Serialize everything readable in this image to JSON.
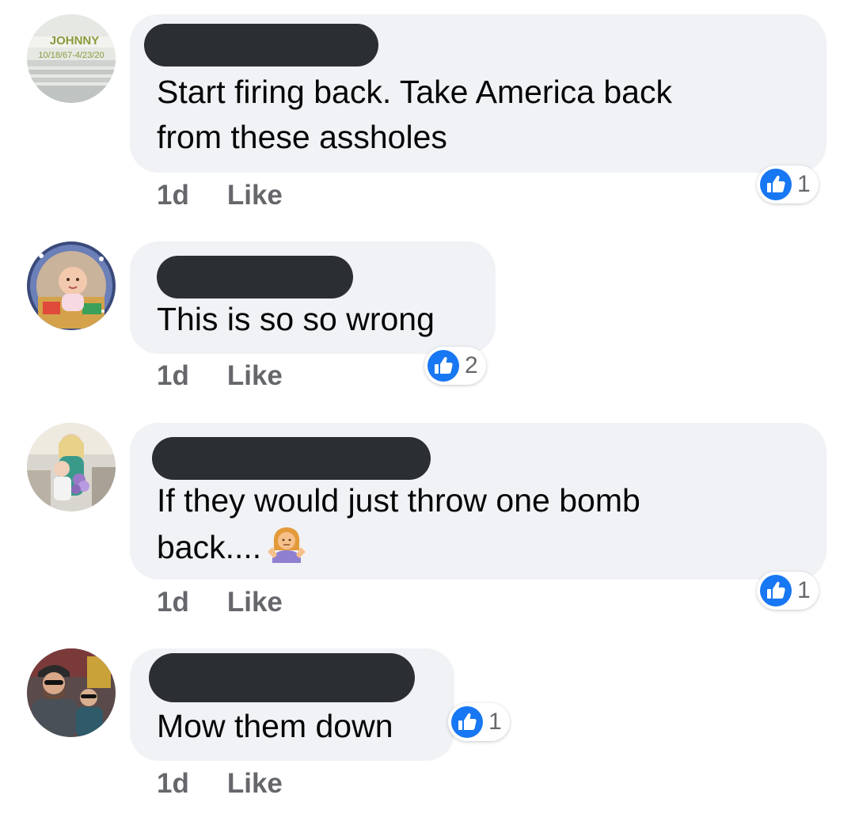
{
  "accent": "#1877f2",
  "comments": [
    {
      "avatar_icon": "memorial-photo-avatar",
      "avatar_text_line1": "JOHNNY",
      "avatar_text_line2": "10/18/67-4/23/20",
      "text_lines": [
        "Start firing back.  Take America back",
        "from these assholes"
      ],
      "time": "1d",
      "like_label": "Like",
      "reaction_icon": "thumbs-up-icon",
      "reaction_count": "1"
    },
    {
      "avatar_icon": "baby-photo-avatar",
      "text_lines": [
        "This is so so wrong"
      ],
      "time": "1d",
      "like_label": "Like",
      "reaction_icon": "thumbs-up-icon",
      "reaction_count": "2"
    },
    {
      "avatar_icon": "woman-with-child-photo-avatar",
      "text_lines": [
        "If they would just throw one bomb",
        "back...."
      ],
      "emoji": "person-shrugging-emoji",
      "time": "1d",
      "like_label": "Like",
      "reaction_icon": "thumbs-up-icon",
      "reaction_count": "1"
    },
    {
      "avatar_icon": "man-and-boy-photo-avatar",
      "text_lines": [
        "Mow them down"
      ],
      "time": "1d",
      "like_label": "Like",
      "reaction_icon": "thumbs-up-icon",
      "reaction_count": "1"
    }
  ]
}
